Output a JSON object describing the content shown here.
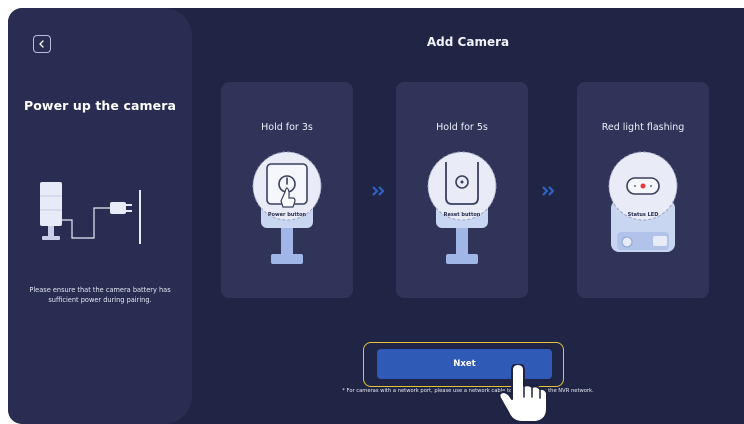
{
  "header": {
    "title": "Add Camera",
    "back_icon": "chevron-left-icon"
  },
  "sidebar": {
    "title": "Power up the camera",
    "note": "Please ensure that the camera battery has sufficient power during pairing."
  },
  "steps": [
    {
      "label": "Hold for 3s",
      "callout": "Power button"
    },
    {
      "label": "Hold for 5s",
      "callout": "Reset button"
    },
    {
      "label": "Red light flashing",
      "callout": "Status LED"
    }
  ],
  "next_button": {
    "label": "Nxet"
  },
  "footnote": "* For cameras with a network port, please use a network cable to connect it to the NVR network.",
  "colors": {
    "background": "#212545",
    "panel": "#292d52",
    "card": "#2f3458",
    "accent": "#2f5bb6",
    "highlight": "#e2c43a",
    "chevron": "#2f62c8"
  }
}
